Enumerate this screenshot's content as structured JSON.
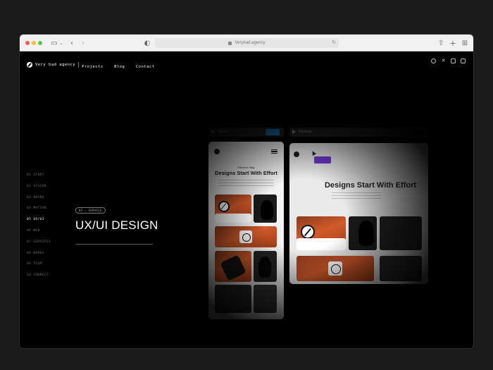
{
  "browser": {
    "url": "Verybad.agency"
  },
  "header": {
    "brand": "Very bad agency",
    "nav": [
      "Projects",
      "Blog",
      "Contact"
    ],
    "social_icons": [
      "dribbble-icon",
      "x-icon",
      "linkedin-icon",
      "instagram-icon"
    ]
  },
  "sidenav": {
    "items": [
      {
        "label": "01 START",
        "active": false
      },
      {
        "label": "02 VISION",
        "active": false
      },
      {
        "label": "03 BRAND",
        "active": false
      },
      {
        "label": "04 MOTION",
        "active": false
      },
      {
        "label": "05 UX/UI",
        "active": true
      },
      {
        "label": "06 WEB",
        "active": false
      },
      {
        "label": "07 SERVICES",
        "active": false
      },
      {
        "label": "08 WORKS",
        "active": false
      },
      {
        "label": "09 TEAM",
        "active": false
      },
      {
        "label": "10 CONNECT",
        "active": false
      }
    ]
  },
  "hero": {
    "badge": "05 — SERVICE",
    "title": "UX/UI DESIGN"
  },
  "mockups": {
    "phone_tab": "Phone",
    "desktop_tab": "Desktop",
    "phone_kicker": "Effective Way",
    "phone_headline": "Designs Start With Effort",
    "desktop_headline": "Designs Start With Effort"
  },
  "colors": {
    "accent_blue": "#1b6fa8",
    "accent_purple": "#6c3ad0",
    "accent_orange": "#d15a2a"
  }
}
